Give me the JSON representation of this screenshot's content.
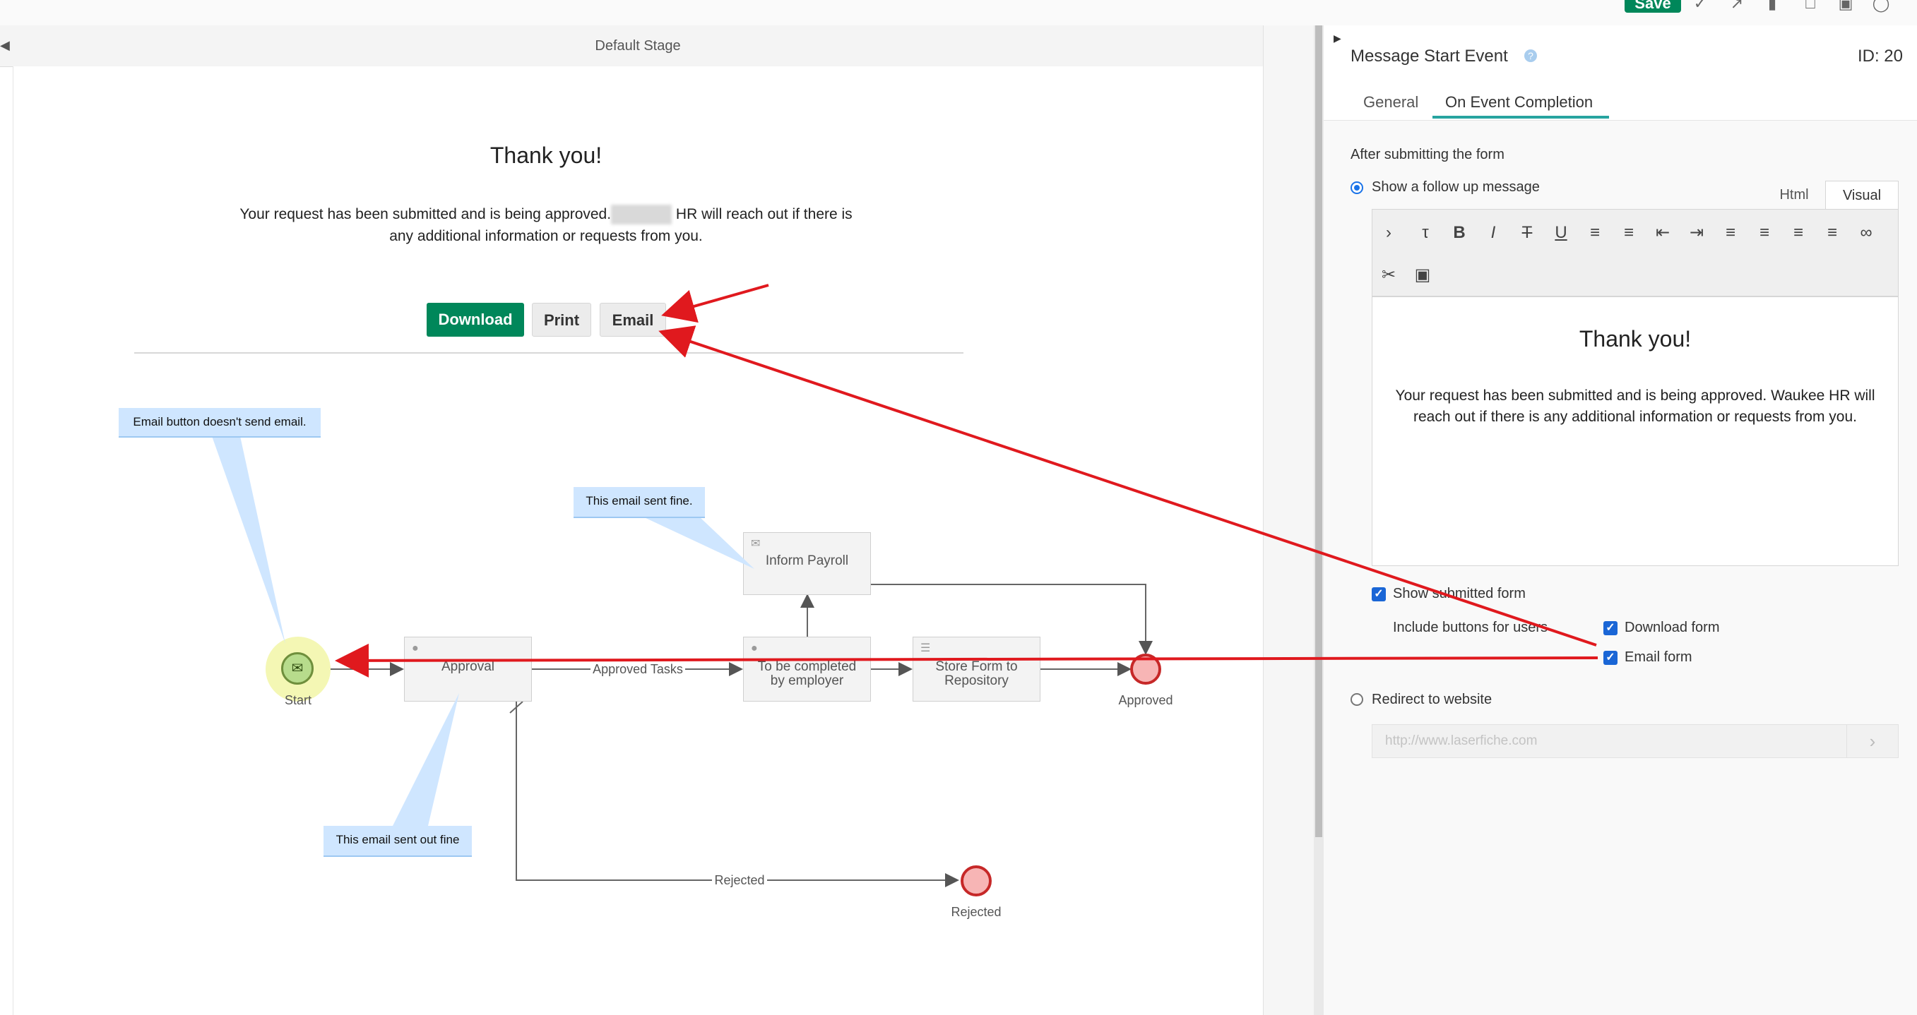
{
  "toolbar": {
    "save_label": "Save",
    "icons": [
      "check-icon",
      "arrow-icon",
      "bars-icon",
      "window-icon",
      "calendar-icon",
      "help-icon"
    ]
  },
  "stage": {
    "title": "Default Stage"
  },
  "form": {
    "title": "Thank you!",
    "message_part1": "Your request has been submitted and is being approved.",
    "message_part2": "HR will reach out if there is",
    "message_line2": "any additional information or requests from you.",
    "buttons": {
      "download": "Download",
      "print": "Print",
      "email": "Email"
    }
  },
  "diagram": {
    "start_label": "Start",
    "approval": "Approval",
    "inform_payroll": "Inform Payroll",
    "employer_task_line1": "To be completed",
    "employer_task_line2": "by employer",
    "store_form_line1": "Store Form to",
    "store_form_line2": "Repository",
    "approved_label": "Approved",
    "rejected_label": "Rejected",
    "edge_approved_tasks": "Approved Tasks",
    "edge_rejected": "Rejected"
  },
  "callouts": {
    "email_button": "Email button doesn't send email.",
    "sent_fine": "This email sent fine.",
    "sent_out_fine": "This email sent out fine"
  },
  "panel": {
    "title": "Message Start Event",
    "id": "ID: 20",
    "tabs": [
      "General",
      "On Event Completion"
    ],
    "active_tab": "On Event Completion",
    "section_heading": "After submitting the form",
    "option_show_message": "Show a follow up message",
    "mode_html": "Html",
    "mode_visual": "Visual",
    "editor": {
      "title": "Thank you!",
      "body_line1": "Your request has been submitted and is being approved.  Waukee HR will",
      "body_line2": "reach out if there is any additional information or requests from you."
    },
    "show_submitted_form": "Show submitted form",
    "include_buttons": "Include buttons for users",
    "download_form": "Download form",
    "email_form": "Email form",
    "option_redirect": "Redirect to website",
    "url_placeholder": "http://www.laserfiche.com"
  },
  "colors": {
    "accent_green": "#00875a",
    "tab_underline": "#27a4a0",
    "annotation_red": "#e0191e",
    "callout_blue": "#cfe6ff",
    "end_event_red": "#c62828"
  }
}
